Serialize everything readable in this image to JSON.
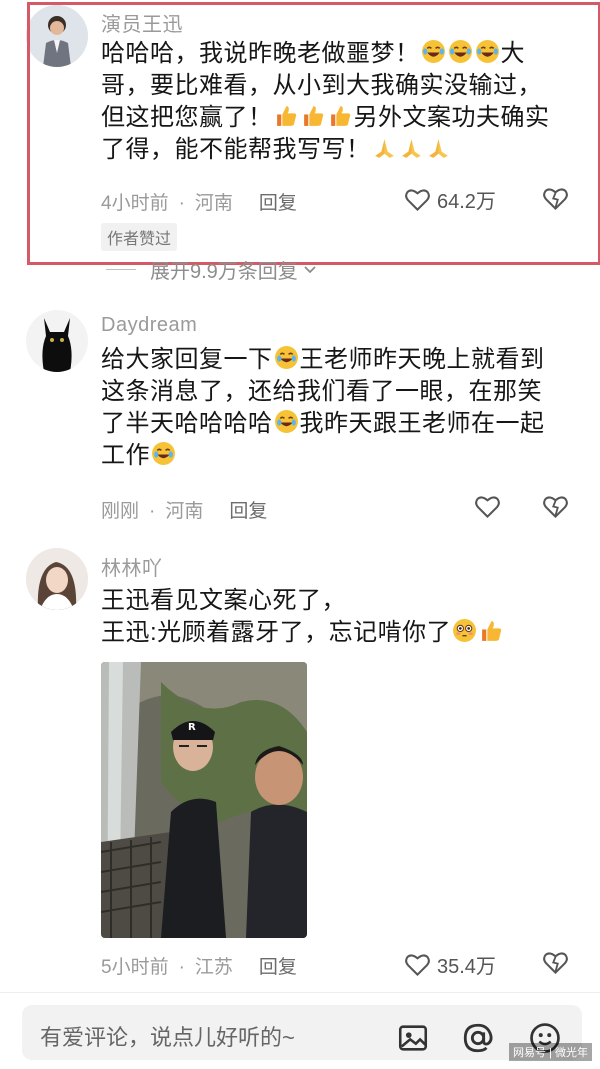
{
  "comments": [
    {
      "username": "演员王迅",
      "lines": [
        "哈哈哈，我说昨晚老做噩梦！",
        "哥，要比难看，从小到大我确实没输过，",
        "但这把您赢了！",
        "了得，能不能帮我写写！"
      ],
      "line1_tail": "大",
      "line3_tail": "另外文案功夫确实",
      "time": "4小时前",
      "location": "河南",
      "reply": "回复",
      "likes": "64.2万",
      "badge": "作者赞过",
      "expand": "展开9.9万条回复"
    },
    {
      "username": "Daydream",
      "line1_a": "给大家回复一下",
      "line1_b": "王老师昨天晚上就看到",
      "line2": "这条消息了，还给我们看了一眼，在那笑",
      "line3_a": "了半天哈哈哈哈",
      "line3_b": "我昨天跟王老师在一起",
      "line4": "工作",
      "time": "刚刚",
      "location": "河南",
      "reply": "回复"
    },
    {
      "username": "林林吖",
      "line1": "王迅看见文案心死了，",
      "line2": "王迅:光顾着露牙了，忘记啃你了",
      "time": "5小时前",
      "location": "江苏",
      "reply": "回复",
      "likes": "35.4万"
    }
  ],
  "input": {
    "placeholder": "有爱评论，说点儿好听的~"
  },
  "icons": [
    "image-icon",
    "at-icon",
    "emoji-icon",
    "heart-icon",
    "dislike-icon"
  ],
  "watermark": "网易号 | 微光年",
  "colors": {
    "highlight": "#d65a66",
    "meta": "#9a9a9a"
  }
}
